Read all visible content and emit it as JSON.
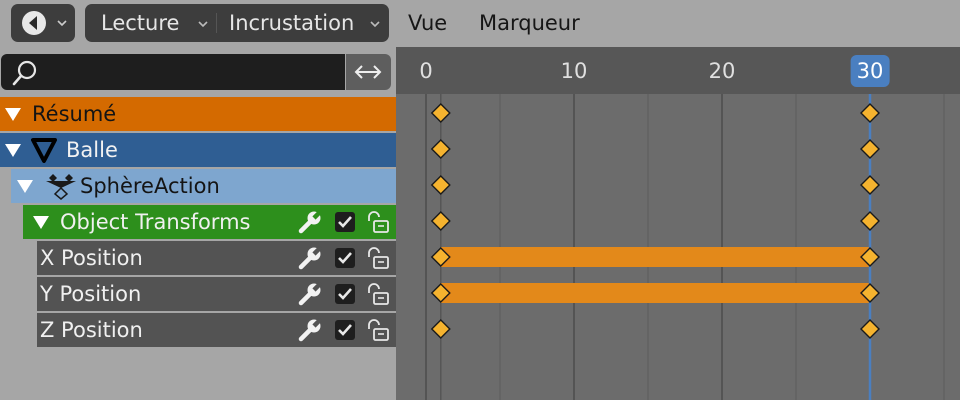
{
  "header": {
    "menus": [
      "Lecture",
      "Incrustation"
    ],
    "plain_menus": [
      "Vue",
      "Marqueur"
    ]
  },
  "search": {
    "value": "",
    "placeholder": ""
  },
  "channels": {
    "summary": "Résumé",
    "object": "Balle",
    "action": "SphèreAction",
    "group": "Object Transforms",
    "items": [
      "X Position",
      "Y Position",
      "Z Position"
    ]
  },
  "timeline": {
    "ruler_labels": [
      "0",
      "10",
      "20"
    ],
    "current_frame": "30",
    "keyframes": [
      1,
      30
    ],
    "hold_rows": [
      4,
      5
    ],
    "row_count": 7
  },
  "colors": {
    "keyframe_fill": "#f5b32f",
    "hold_bar": "#e3891a",
    "playhead": "#4a7fc0",
    "summary_row": "#d46a00",
    "object_row": "#2f5e93",
    "action_row": "#7ea6cf",
    "group_row": "#2d8f1c"
  }
}
